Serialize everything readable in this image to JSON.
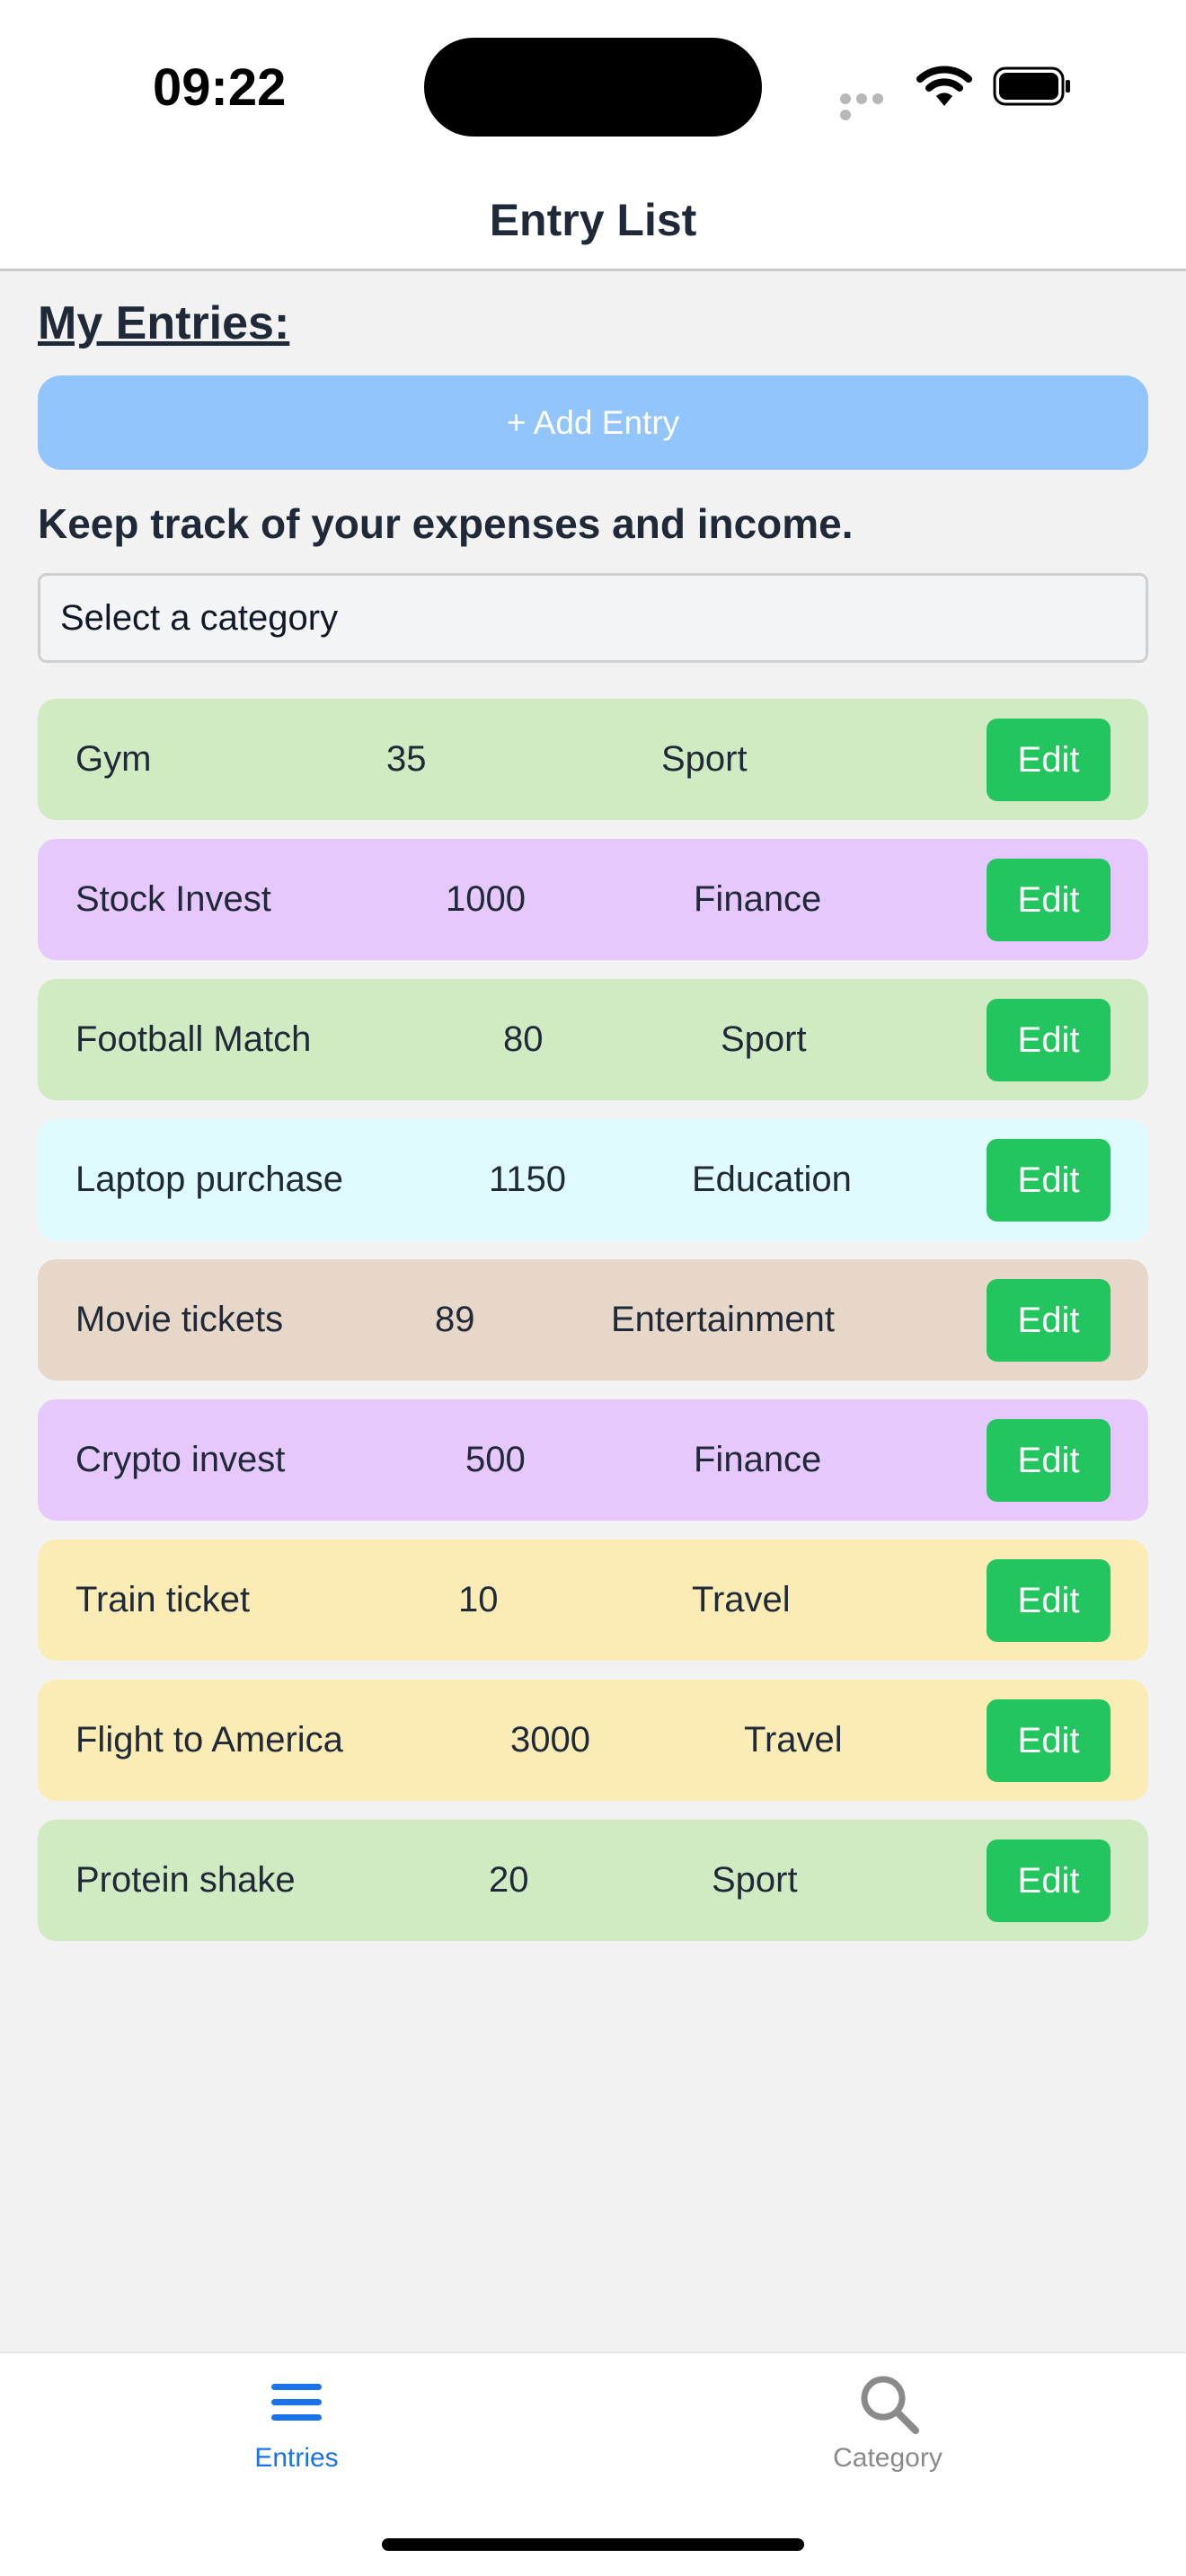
{
  "status": {
    "time": "09:22"
  },
  "header": {
    "title": "Entry List"
  },
  "main": {
    "section_title": "My Entries:",
    "add_button": "+ Add Entry",
    "subtitle": "Keep track of your expenses and income.",
    "category_select": "Select a category"
  },
  "entries": [
    {
      "name": "Gym",
      "amount": "35",
      "category": "Sport",
      "edit": "Edit",
      "color": "#d0eac2"
    },
    {
      "name": "Stock Invest",
      "amount": "1000",
      "category": "Finance",
      "edit": "Edit",
      "color": "#e6c8fc"
    },
    {
      "name": "Football Match",
      "amount": "80",
      "category": "Sport",
      "edit": "Edit",
      "color": "#d0eac2"
    },
    {
      "name": "Laptop purchase",
      "amount": "1150",
      "category": "Education",
      "edit": "Edit",
      "color": "#e0fbfd"
    },
    {
      "name": "Movie tickets",
      "amount": "89",
      "category": "Entertainment",
      "edit": "Edit",
      "color": "#e7d7c9"
    },
    {
      "name": "Crypto invest",
      "amount": "500",
      "category": "Finance",
      "edit": "Edit",
      "color": "#e6c8fc"
    },
    {
      "name": "Train ticket",
      "amount": "10",
      "category": "Travel",
      "edit": "Edit",
      "color": "#faecb4"
    },
    {
      "name": "Flight to America",
      "amount": "3000",
      "category": "Travel",
      "edit": "Edit",
      "color": "#faecb4"
    },
    {
      "name": "Protein shake",
      "amount": "20",
      "category": "Sport",
      "edit": "Edit",
      "color": "#d0eac2"
    }
  ],
  "tabbar": {
    "entries_label": "Entries",
    "entries_icon": "menu-icon",
    "category_label": "Category",
    "category_icon": "search-icon",
    "active_color": "#1a73e8",
    "inactive_color": "#8a8a8a"
  },
  "colors": {
    "accent": "#22c55e",
    "add_button": "#93c5fd"
  }
}
